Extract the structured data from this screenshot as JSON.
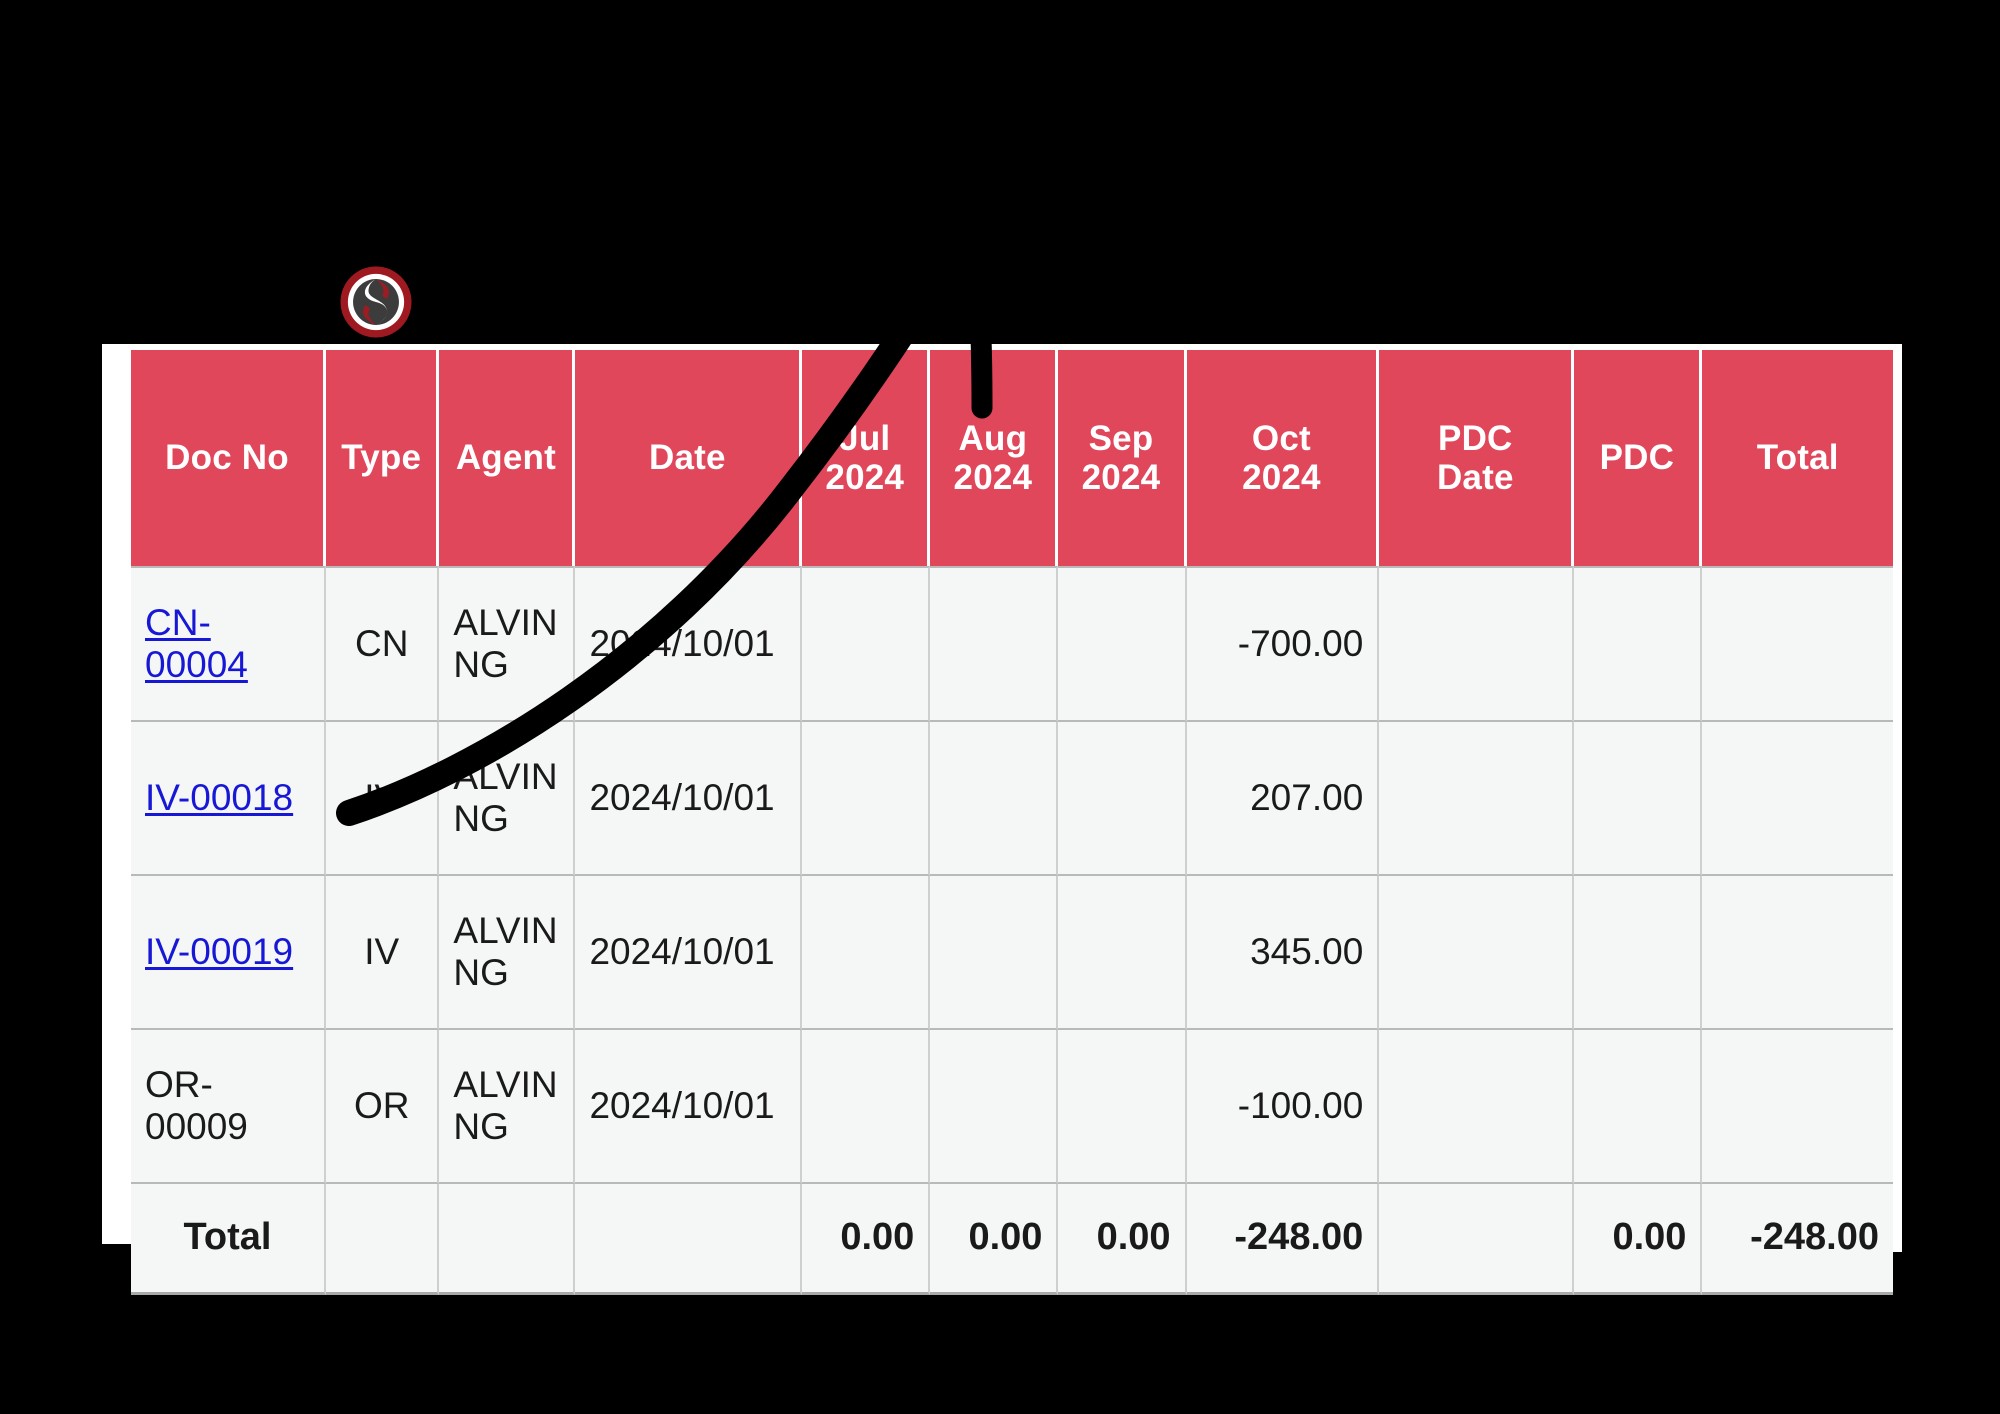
{
  "logo": {
    "icon": "s-monogram-circle-logo",
    "letter": "S",
    "ring_color": "#9e1a20",
    "inner_color": "#ffffff",
    "core_color": "#3a3a3a"
  },
  "table": {
    "accent_color": "#e0475a",
    "link_color": "#1718d6",
    "columns": [
      {
        "key": "doc_no",
        "label": "Doc No"
      },
      {
        "key": "type",
        "label": "Type"
      },
      {
        "key": "agent",
        "label": "Agent"
      },
      {
        "key": "date",
        "label": "Date"
      },
      {
        "key": "jul_2024",
        "label": "Jul\n2024"
      },
      {
        "key": "aug_2024",
        "label": "Aug\n2024"
      },
      {
        "key": "sep_2024",
        "label": "Sep\n2024"
      },
      {
        "key": "oct_2024",
        "label": "Oct\n2024"
      },
      {
        "key": "pdc_date",
        "label": "PDC\nDate"
      },
      {
        "key": "pdc",
        "label": "PDC"
      },
      {
        "key": "total",
        "label": "Total"
      }
    ],
    "column_labels": {
      "doc_no": "Doc No",
      "type": "Type",
      "agent": "Agent",
      "date": "Date",
      "jul_line1": "Jul",
      "jul_line2": "2024",
      "aug_line1": "Aug",
      "aug_line2": "2024",
      "sep_line1": "Sep",
      "sep_line2": "2024",
      "oct_line1": "Oct",
      "oct_line2": "2024",
      "pdc_date_line1": "PDC",
      "pdc_date_line2": "Date",
      "pdc": "PDC",
      "total": "Total"
    },
    "rows": [
      {
        "doc_no": "CN-00004",
        "doc_no_is_link": true,
        "type": "CN",
        "agent": "ALVIN NG",
        "date": "2024/10/01",
        "jul_2024": "",
        "aug_2024": "",
        "sep_2024": "",
        "oct_2024": "-700.00",
        "pdc_date": "",
        "pdc": "",
        "total": ""
      },
      {
        "doc_no": "IV-00018",
        "doc_no_is_link": true,
        "type": "IV",
        "agent": "ALVIN NG",
        "date": "2024/10/01",
        "jul_2024": "",
        "aug_2024": "",
        "sep_2024": "",
        "oct_2024": "207.00",
        "pdc_date": "",
        "pdc": "",
        "total": ""
      },
      {
        "doc_no": "IV-00019",
        "doc_no_is_link": true,
        "type": "IV",
        "agent": "ALVIN NG",
        "date": "2024/10/01",
        "jul_2024": "",
        "aug_2024": "",
        "sep_2024": "",
        "oct_2024": "345.00",
        "pdc_date": "",
        "pdc": "",
        "total": ""
      },
      {
        "doc_no": "OR-00009",
        "doc_no_is_link": false,
        "type": "OR",
        "agent": "ALVIN NG",
        "date": "2024/10/01",
        "jul_2024": "",
        "aug_2024": "",
        "sep_2024": "",
        "oct_2024": "-100.00",
        "pdc_date": "",
        "pdc": "",
        "total": ""
      }
    ],
    "total_row": {
      "label": "Total",
      "type": "",
      "agent": "",
      "date": "",
      "jul_2024": "0.00",
      "aug_2024": "0.00",
      "sep_2024": "0.00",
      "oct_2024": "-248.00",
      "pdc_date": "",
      "pdc": "0.00",
      "total": "-248.00"
    }
  },
  "annotation": {
    "type": "handwritten-check-mark",
    "color": "#000000",
    "description": "thick black hand-drawn curved stroke with a short vertical tick"
  }
}
